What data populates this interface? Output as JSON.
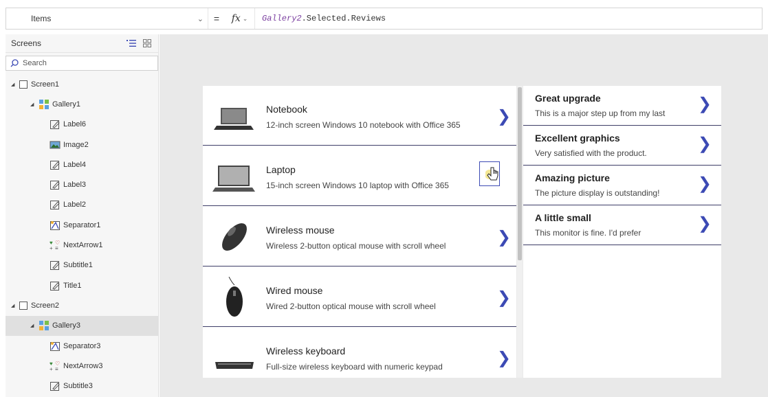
{
  "formula_bar": {
    "property": "Items",
    "equals": "=",
    "fx": "fx",
    "formula_object": "Gallery2",
    "formula_rest": ".Selected.Reviews"
  },
  "tree_view": {
    "title": "Screens",
    "search_placeholder": "Search",
    "nodes": [
      {
        "label": "Screen1",
        "indent": 0,
        "type": "screen",
        "expanded": true
      },
      {
        "label": "Gallery1",
        "indent": 1,
        "type": "gallery",
        "expanded": true
      },
      {
        "label": "Label6",
        "indent": 2,
        "type": "label"
      },
      {
        "label": "Image2",
        "indent": 2,
        "type": "image"
      },
      {
        "label": "Label4",
        "indent": 2,
        "type": "label"
      },
      {
        "label": "Label3",
        "indent": 2,
        "type": "label"
      },
      {
        "label": "Label2",
        "indent": 2,
        "type": "label"
      },
      {
        "label": "Separator1",
        "indent": 2,
        "type": "separator"
      },
      {
        "label": "NextArrow1",
        "indent": 2,
        "type": "icon"
      },
      {
        "label": "Subtitle1",
        "indent": 2,
        "type": "label"
      },
      {
        "label": "Title1",
        "indent": 2,
        "type": "label"
      },
      {
        "label": "Screen2",
        "indent": 0,
        "type": "screen",
        "expanded": true
      },
      {
        "label": "Gallery3",
        "indent": 1,
        "type": "gallery",
        "expanded": true,
        "selected": true
      },
      {
        "label": "Separator3",
        "indent": 2,
        "type": "separator"
      },
      {
        "label": "NextArrow3",
        "indent": 2,
        "type": "icon"
      },
      {
        "label": "Subtitle3",
        "indent": 2,
        "type": "label"
      }
    ]
  },
  "products": [
    {
      "title": "Notebook",
      "subtitle": "12-inch screen Windows 10 notebook with Office 365",
      "icon": "laptop-icon"
    },
    {
      "title": "Laptop",
      "subtitle": "15-inch screen Windows 10 laptop with Office 365",
      "icon": "laptop-icon",
      "selected": true
    },
    {
      "title": "Wireless mouse",
      "subtitle": "Wireless 2-button optical mouse with scroll wheel",
      "icon": "mouse-icon"
    },
    {
      "title": "Wired mouse",
      "subtitle": "Wired 2-button optical mouse with scroll wheel",
      "icon": "wired-mouse-icon"
    },
    {
      "title": "Wireless keyboard",
      "subtitle": "Full-size wireless keyboard with numeric keypad",
      "icon": "keyboard-icon"
    }
  ],
  "reviews": [
    {
      "title": "Great upgrade",
      "text": "This is a major step up from my last"
    },
    {
      "title": "Excellent graphics",
      "text": "Very satisfied with the product."
    },
    {
      "title": "Amazing picture",
      "text": "The picture display is outstanding!"
    },
    {
      "title": "A little small",
      "text": "This monitor is fine. I'd prefer"
    }
  ],
  "colors": {
    "accent": "#3c4ab4",
    "separator": "#3c3c66",
    "canvas": "#e9e9e9",
    "selected_node": "#e0e0e0"
  }
}
